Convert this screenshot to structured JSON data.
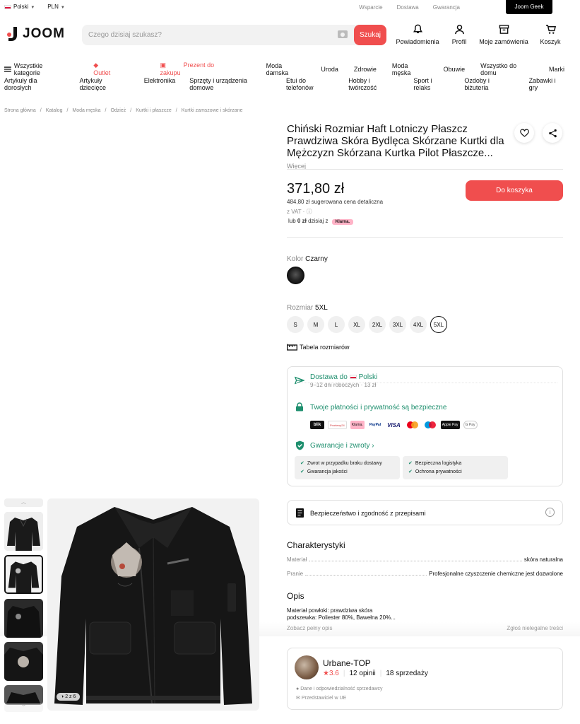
{
  "topbar": {
    "language": "Polski",
    "currency": "PLN",
    "links": [
      "Wsparcie",
      "Dostawa",
      "Gwarancja"
    ],
    "geek": "Joom Geek"
  },
  "header": {
    "logo": "JOOM",
    "search_placeholder": "Czego dzisiaj szukasz?",
    "search_button": "Szukaj",
    "icons": [
      {
        "label": "Powiadomienia",
        "icon": "bell-icon"
      },
      {
        "label": "Profil",
        "icon": "user-icon"
      },
      {
        "label": "Moje zamówienia",
        "icon": "box-icon"
      },
      {
        "label": "Koszyk",
        "icon": "cart-icon"
      }
    ]
  },
  "nav": {
    "all_categories": "Wszystkie kategorie",
    "outlet": "Outlet",
    "gift": "Prezent do zakupu",
    "row1": [
      "Moda damska",
      "Uroda",
      "Zdrowie",
      "Moda męska",
      "Obuwie",
      "Wszystko do domu",
      "Marki"
    ],
    "row2": [
      "Artykuły dla dorosłych",
      "Artykuły dziecięce",
      "Elektronika",
      "Sprzęty i urządzenia domowe",
      "Etui do telefonów",
      "Hobby i twórczość",
      "Sport i relaks",
      "Ozdoby i biżuteria",
      "Zabawki i gry"
    ]
  },
  "breadcrumb": [
    "Strona główna",
    "Katalog",
    "Moda męska",
    "Odzież",
    "Kurtki i płaszcze",
    "Kurtki zamszowe i skórzane"
  ],
  "product": {
    "title": "Chiński Rozmiar Haft Lotniczy Płaszcz Prawdziwa Skóra Bydlęca Skórzane Kurtki dla Mężczyzn Skórzana Kurtka Pilot Płaszcze...",
    "more": "Więcej",
    "price": "371,80 zł",
    "suggested": "484,80 zł sugerowana cena detaliczna",
    "vat": "z VAT ·",
    "klarna_prefix": "lub",
    "klarna_amount": "0 zł",
    "klarna_suffix": "dzisiaj z",
    "klarna_badge": "Klarna.",
    "cart_button": "Do koszyka",
    "color_label": "Kolor",
    "color_value": "Czarny",
    "size_label": "Rozmiar",
    "size_value": "5XL",
    "sizes": [
      "S",
      "M",
      "L",
      "XL",
      "2XL",
      "3XL",
      "4XL",
      "5XL"
    ],
    "size_table": "Tabela rozmiarów"
  },
  "delivery": {
    "title_prefix": "Dostawa do",
    "country": "Polski",
    "sub": "9–12 dni roboczych · 13 zł",
    "secure": "Twoje płatności i prywatność są bezpieczne",
    "payments": [
      "blik",
      "Przelewy24",
      "Klarna.",
      "PayPal",
      "VISA",
      "mastercard",
      "maestro",
      "Apple Pay",
      "G Pay"
    ],
    "guarantee": "Gwarancje i zwroty",
    "guarantee_items_left": [
      "Zwrot w przypadku braku dostawy",
      "Gwarancja jakości"
    ],
    "guarantee_items_right": [
      "Bezpieczna logistyka",
      "Ochrona prywatności"
    ]
  },
  "safety": "Bezpieczeństwo i zgodność z przepisami",
  "specs": {
    "title": "Charakterystyki",
    "rows": [
      {
        "k": "Materiał",
        "v": "skóra naturalna"
      },
      {
        "k": "Pranie",
        "v": "Profesjonalne czyszczenie chemiczne jest dozwolone"
      }
    ]
  },
  "description": {
    "title": "Opis",
    "line1": "Materiał powłoki: prawdziwa skóra",
    "line2": "podszewka: Poliester 80%, Bawełna 20%...",
    "full": "Zobacz pełny opis",
    "report": "Zgłoś nielegalne treści"
  },
  "seller": {
    "name": "Urbane-TOP",
    "rating": "3.6",
    "reviews": "12 opinii",
    "sales": "18 sprzedaży",
    "line1": "Dane i odpowiedzialność sprzedawcy",
    "line2": "Przedstawiciel w UE"
  },
  "gallery": {
    "counter": "2 z 6"
  }
}
